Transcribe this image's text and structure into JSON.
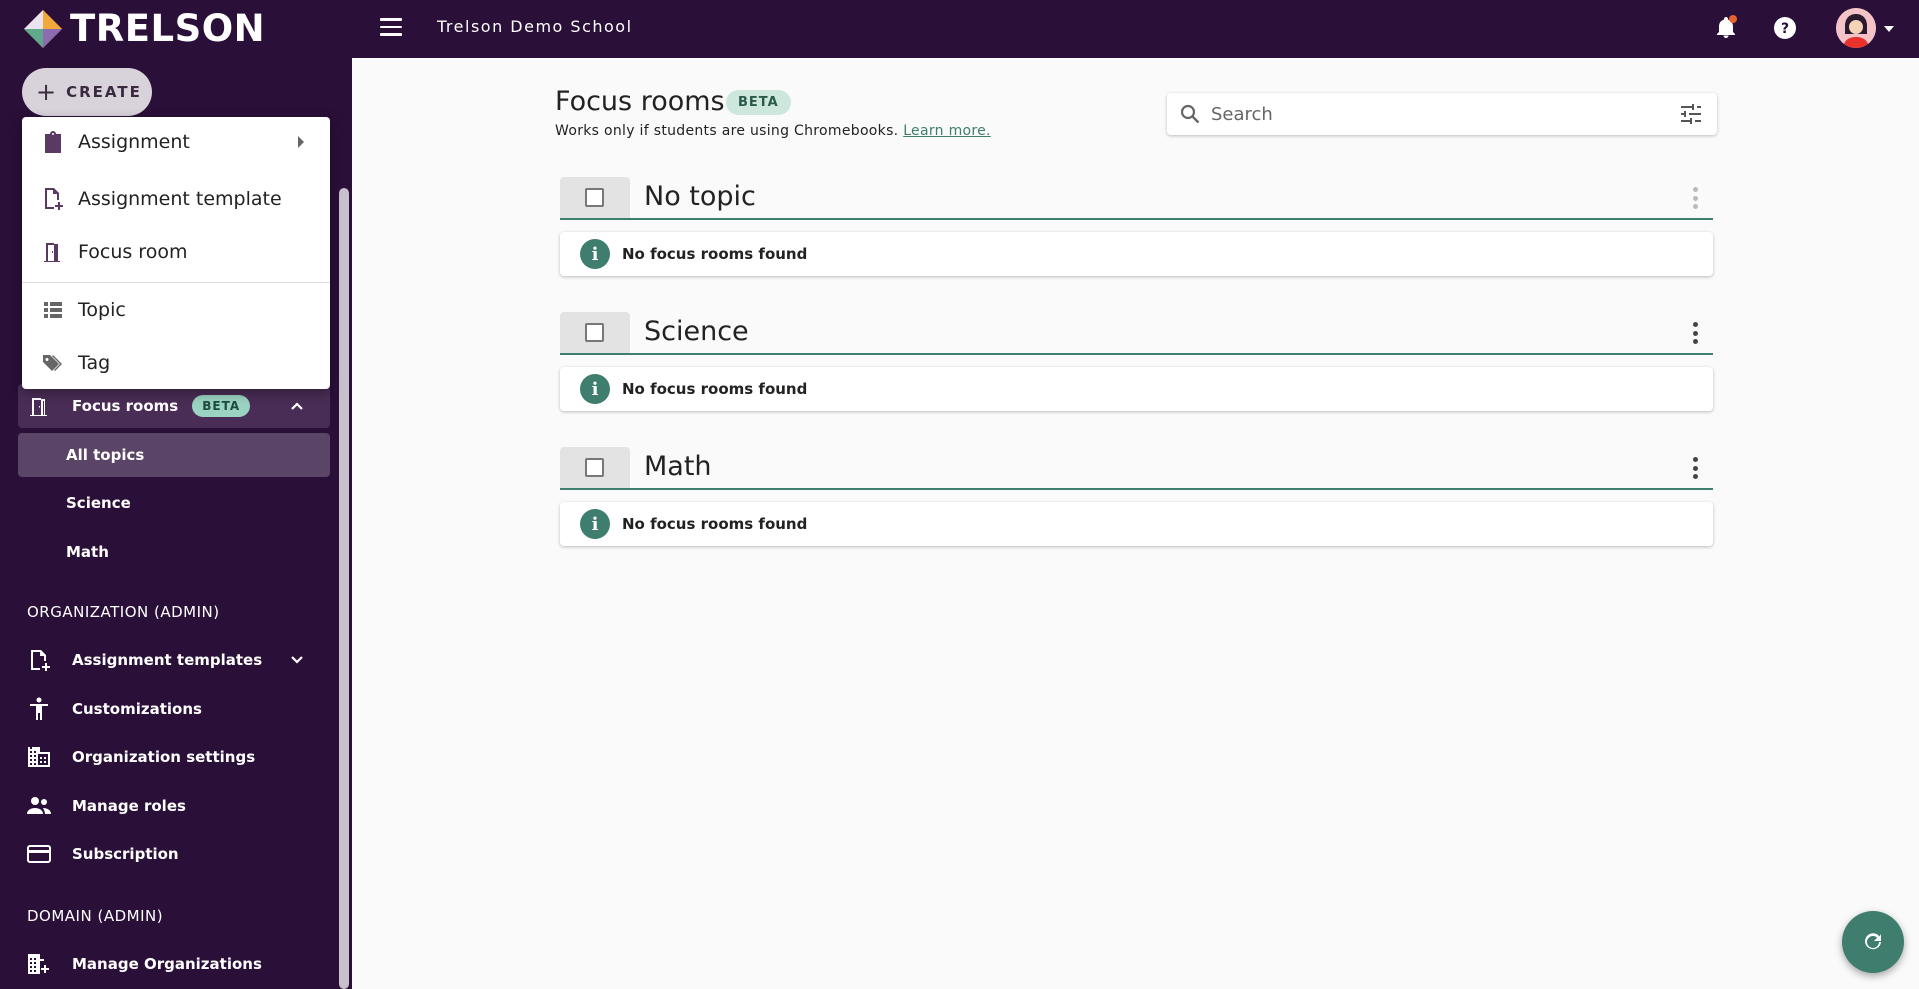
{
  "app": {
    "brand": "TRELSON",
    "org_name": "Trelson Demo School"
  },
  "topbar": {
    "notification_dot_color": "#e8622c"
  },
  "sidebar": {
    "create_label": "CREATE",
    "focus_rooms": {
      "label": "Focus rooms",
      "badge": "BETA"
    },
    "focus_room_topics": [
      {
        "label": "All topics",
        "selected": true
      },
      {
        "label": "Science",
        "selected": false
      },
      {
        "label": "Math",
        "selected": false
      }
    ],
    "org_section_label": "ORGANIZATION (ADMIN)",
    "org_items": [
      {
        "label": "Assignment templates",
        "icon": "file-plus-icon"
      },
      {
        "label": "Customizations",
        "icon": "accessibility-icon"
      },
      {
        "label": "Organization settings",
        "icon": "building-icon"
      },
      {
        "label": "Manage roles",
        "icon": "people-icon"
      },
      {
        "label": "Subscription",
        "icon": "credit-card-icon"
      }
    ],
    "domain_section_label": "DOMAIN (ADMIN)",
    "domain_items": [
      {
        "label": "Manage Organizations",
        "icon": "buildings-icon"
      }
    ]
  },
  "create_menu": {
    "items": [
      {
        "label": "Assignment",
        "icon": "clipboard-icon",
        "has_submenu": true
      },
      {
        "label": "Assignment template",
        "icon": "file-plus-icon"
      },
      {
        "label": "Focus room",
        "icon": "door-icon"
      },
      {
        "label": "Topic",
        "icon": "list-icon"
      },
      {
        "label": "Tag",
        "icon": "tag-icon"
      }
    ]
  },
  "main": {
    "title": "Focus rooms",
    "title_badge": "BETA",
    "subtitle": "Works only if students are using Chromebooks.",
    "learn_more": "Learn more.",
    "search_placeholder": "Search",
    "topics": [
      {
        "name": "No topic",
        "empty_text": "No focus rooms found"
      },
      {
        "name": "Science",
        "empty_text": "No focus rooms found"
      },
      {
        "name": "Math",
        "empty_text": "No focus rooms found"
      }
    ]
  },
  "colors": {
    "primary_dark": "#2a0f38",
    "accent": "#3f7d6e"
  }
}
